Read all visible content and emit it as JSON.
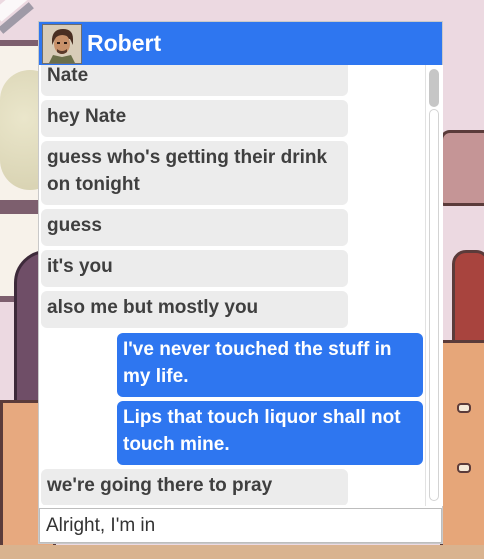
{
  "chat": {
    "contact_name": "Robert",
    "messages": [
      {
        "from": "Robert",
        "text": "Nate"
      },
      {
        "from": "Robert",
        "text": "hey Nate"
      },
      {
        "from": "Robert",
        "text": "guess who's getting their drink on tonight"
      },
      {
        "from": "Robert",
        "text": "guess"
      },
      {
        "from": "Robert",
        "text": "it's you"
      },
      {
        "from": "Robert",
        "text": "also me but mostly you"
      },
      {
        "from": "me",
        "text": "I've never touched the stuff in my life."
      },
      {
        "from": "me",
        "text": "Lips that touch liquor shall not touch mine."
      },
      {
        "from": "Robert",
        "text": "we're going there to pray"
      }
    ],
    "reply_text": "Alright, I'm in"
  },
  "colors": {
    "header": "#2e76f0",
    "outgoing_bubble": "#2e76f0",
    "incoming_bubble": "#ececec"
  }
}
